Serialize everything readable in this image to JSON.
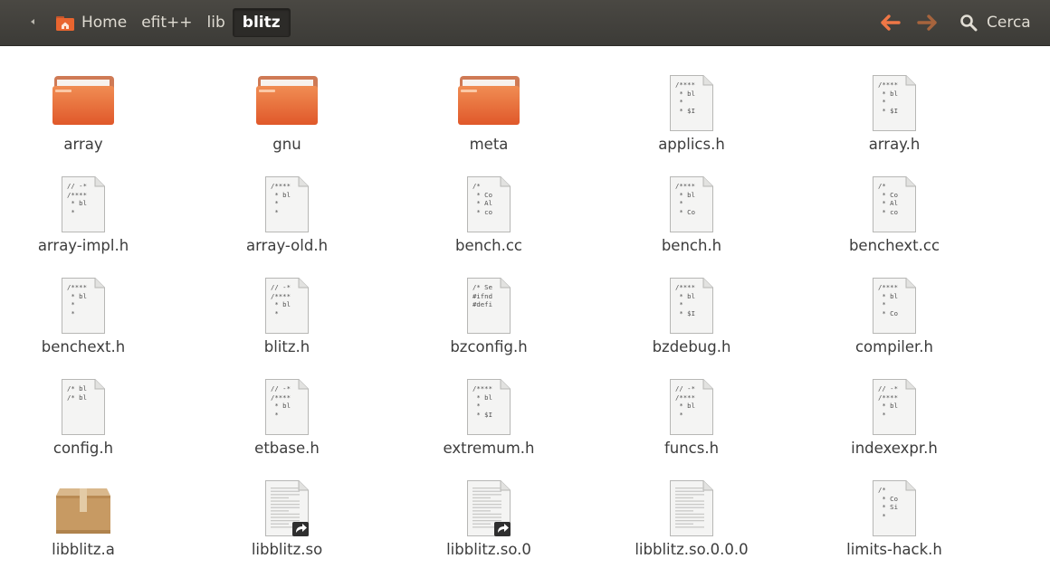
{
  "toolbar": {
    "breadcrumbs": [
      "Home",
      "efit++",
      "lib",
      "blitz"
    ],
    "search_label": "Cerca"
  },
  "files": [
    {
      "name": "array",
      "type": "folder"
    },
    {
      "name": "gnu",
      "type": "folder"
    },
    {
      "name": "meta",
      "type": "folder"
    },
    {
      "name": "applics.h",
      "type": "text",
      "preview": "/****\n * bl\n *\n * $I"
    },
    {
      "name": "array.h",
      "type": "text",
      "preview": "/****\n * bl\n *\n * $I"
    },
    {
      "name": "array-impl.h",
      "type": "text",
      "preview": "// -*\n/****\n * bl\n *"
    },
    {
      "name": "array-old.h",
      "type": "text",
      "preview": "/****\n * bl\n *\n *"
    },
    {
      "name": "bench.cc",
      "type": "text",
      "preview": "/*\n * Co\n * Al\n * co"
    },
    {
      "name": "bench.h",
      "type": "text",
      "preview": "/****\n * bl\n *\n * Co"
    },
    {
      "name": "benchext.cc",
      "type": "text",
      "preview": "/*\n * Co\n * Al\n * co"
    },
    {
      "name": "benchext.h",
      "type": "text",
      "preview": "/****\n * bl\n *\n *"
    },
    {
      "name": "blitz.h",
      "type": "text",
      "preview": "// -*\n/****\n * bl\n *"
    },
    {
      "name": "bzconfig.h",
      "type": "text",
      "preview": "/* Se\n#ifnd\n#defi"
    },
    {
      "name": "bzdebug.h",
      "type": "text",
      "preview": "/****\n * bl\n *\n * $I"
    },
    {
      "name": "compiler.h",
      "type": "text",
      "preview": "/****\n * bl\n *\n * Co"
    },
    {
      "name": "config.h",
      "type": "text",
      "preview": "/* bl\n/* bl"
    },
    {
      "name": "etbase.h",
      "type": "text",
      "preview": "// -*\n/****\n * bl\n *"
    },
    {
      "name": "extremum.h",
      "type": "text",
      "preview": "/****\n * bl\n *\n * $I"
    },
    {
      "name": "funcs.h",
      "type": "text",
      "preview": "// -*\n/****\n * bl\n *"
    },
    {
      "name": "indexexpr.h",
      "type": "text",
      "preview": "// -*\n/****\n * bl\n *"
    },
    {
      "name": "libblitz.a",
      "type": "archive"
    },
    {
      "name": "libblitz.so",
      "type": "symlink"
    },
    {
      "name": "libblitz.so.0",
      "type": "symlink"
    },
    {
      "name": "libblitz.so.0.0.0",
      "type": "binary"
    },
    {
      "name": "limits-hack.h",
      "type": "text",
      "preview": "/*\n * Co\n * Si\n *"
    }
  ]
}
